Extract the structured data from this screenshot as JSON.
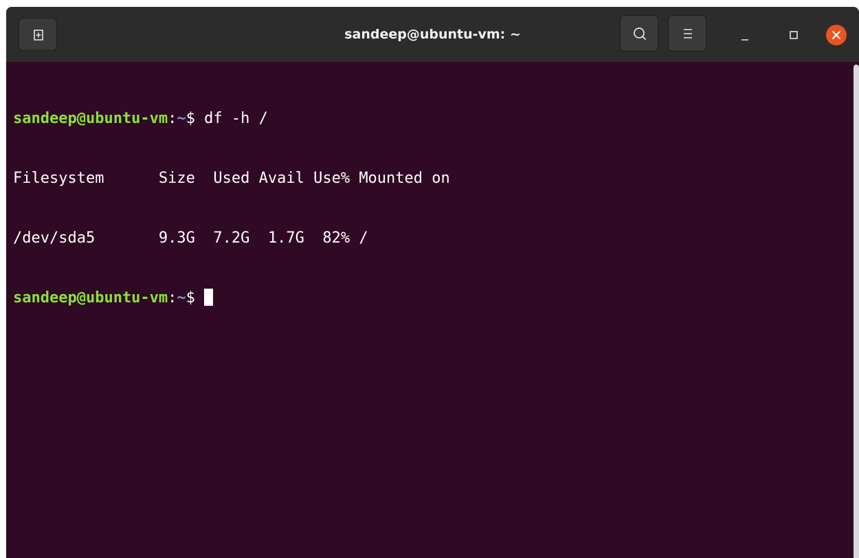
{
  "window": {
    "title": "sandeep@ubuntu-vm: ~"
  },
  "icons": {
    "new_tab": "new-tab-icon",
    "search": "search-icon",
    "menu": "hamburger-menu-icon",
    "minimize": "minimize-icon",
    "maximize": "maximize-icon",
    "close": "close-icon"
  },
  "colors": {
    "terminal_bg": "#300a24",
    "titlebar_bg": "#2c2c2c",
    "prompt_user": "#8ae234",
    "prompt_path": "#729fcf",
    "close_button": "#e95420"
  },
  "terminal": {
    "lines": [
      {
        "prompt_user": "sandeep@ubuntu-vm",
        "prompt_sep": ":",
        "prompt_path": "~",
        "prompt_symbol": "$ ",
        "command": "df -h /"
      },
      {
        "text": "Filesystem      Size  Used Avail Use% Mounted on"
      },
      {
        "text": "/dev/sda5       9.3G  7.2G  1.7G  82% /"
      },
      {
        "prompt_user": "sandeep@ubuntu-vm",
        "prompt_sep": ":",
        "prompt_path": "~",
        "prompt_symbol": "$ ",
        "command": ""
      }
    ]
  }
}
